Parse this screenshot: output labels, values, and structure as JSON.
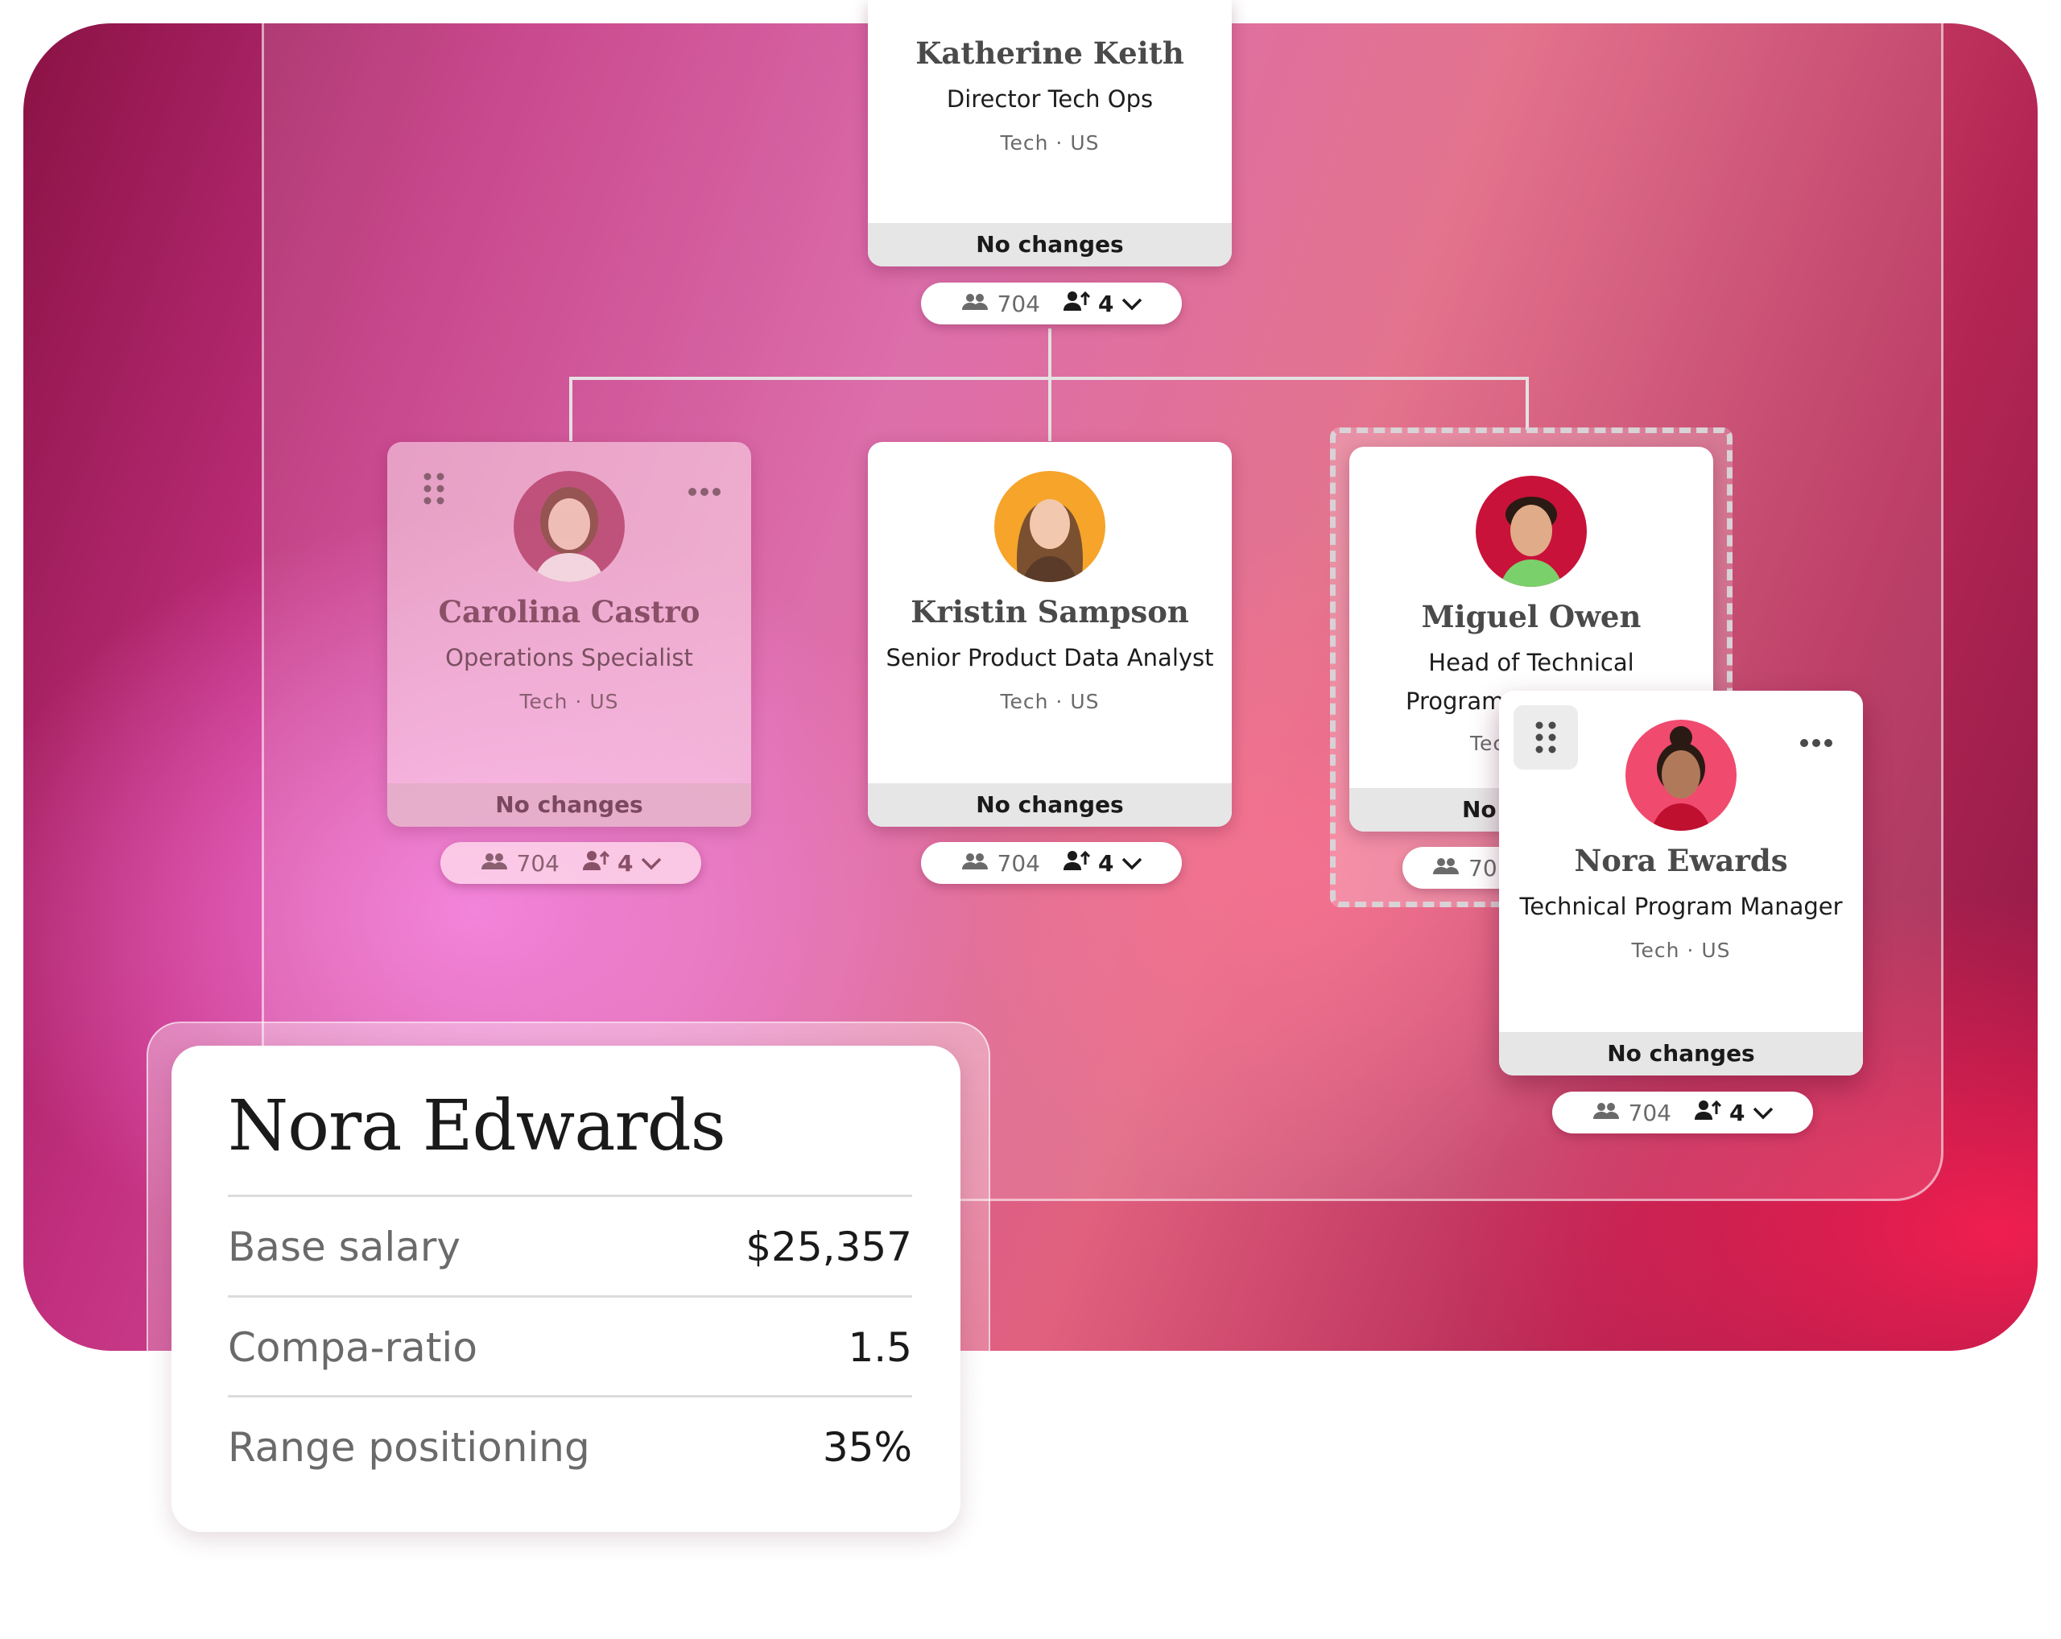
{
  "org_chart": {
    "top": {
      "name": "Katherine Keith",
      "title": "Director Tech Ops",
      "meta": "Tech · US",
      "status": "No changes",
      "headcount": "704",
      "reports": "4"
    },
    "children": [
      {
        "name": "Carolina Castro",
        "title": "Operations Specialist",
        "meta": "Tech · US",
        "status": "No changes",
        "headcount": "704",
        "reports": "4",
        "state": "dragging-source"
      },
      {
        "name": "Kristin Sampson",
        "title": "Senior Product Data Analyst",
        "meta": "Tech · US",
        "status": "No changes",
        "headcount": "704",
        "reports": "4"
      },
      {
        "name": "Miguel Owen",
        "title_line1": "Head of Technical",
        "title_line2": "Program M…",
        "meta": "Tec",
        "status": "No",
        "headcount": "70",
        "state": "drop-target"
      }
    ],
    "floating": {
      "name": "Nora Ewards",
      "title": "Technical Program Manager",
      "meta": "Tech · US",
      "status": "No changes",
      "headcount": "704",
      "reports": "4"
    }
  },
  "detail": {
    "name": "Nora Edwards",
    "rows": [
      {
        "label": "Base salary",
        "value": "$25,357"
      },
      {
        "label": "Compa-ratio",
        "value": "1.5"
      },
      {
        "label": "Range positioning",
        "value": "35%"
      }
    ]
  },
  "colors": {
    "brand_dark": "#8a1244",
    "brand_pink": "#d85aa0",
    "brand_red": "#f01e50"
  },
  "icons": {
    "headcount": "people-icon",
    "reports": "person-arrow-icon",
    "expand": "chevron-down-icon",
    "drag": "drag-handle-icon",
    "more": "more-options-icon"
  }
}
